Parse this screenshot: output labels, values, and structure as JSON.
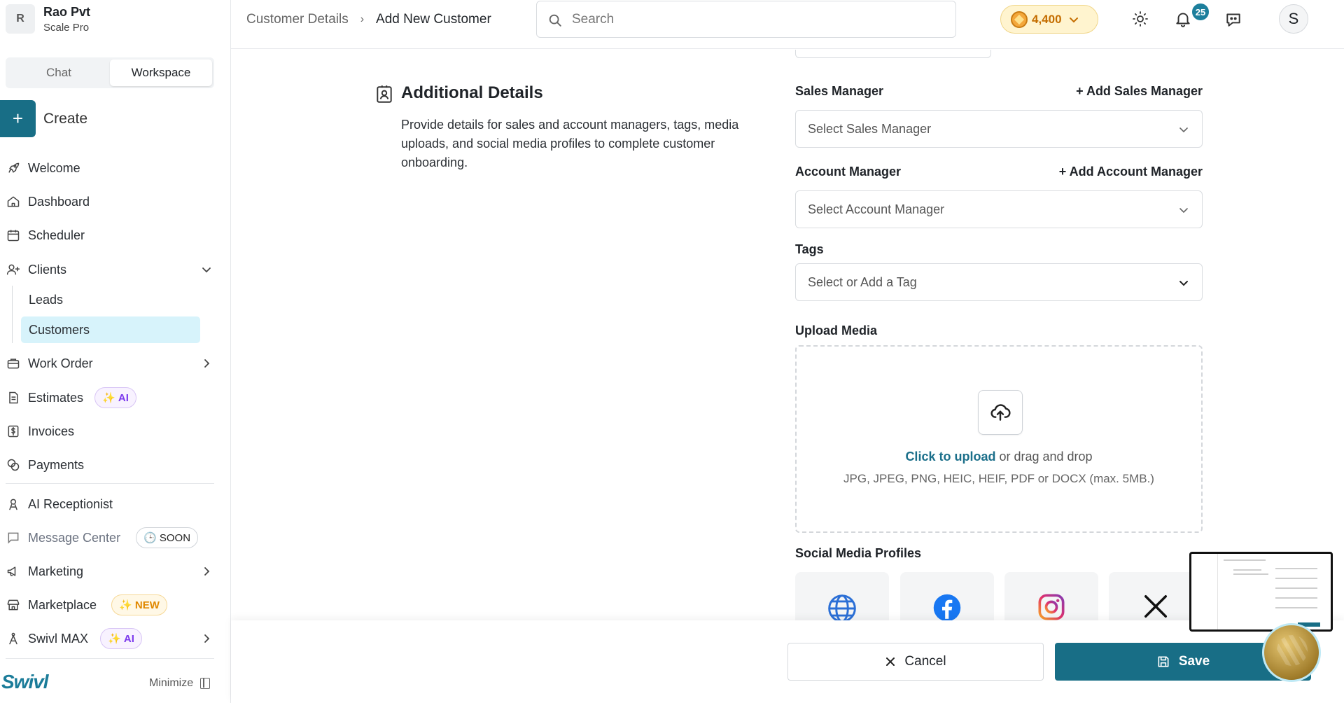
{
  "org": {
    "initial": "R",
    "name": "Rao Pvt",
    "plan": "Scale Pro"
  },
  "mode_tabs": [
    {
      "label": "Chat",
      "active": false
    },
    {
      "label": "Workspace",
      "active": true
    }
  ],
  "create_label": "Create",
  "nav": {
    "welcome": "Welcome",
    "dashboard": "Dashboard",
    "scheduler": "Scheduler",
    "clients": "Clients",
    "leads": "Leads",
    "customers": "Customers",
    "work_order": "Work Order",
    "estimates": "Estimates",
    "invoices": "Invoices",
    "payments": "Payments",
    "ai_receptionist": "AI Receptionist",
    "message_center": "Message Center",
    "marketing": "Marketing",
    "marketplace": "Marketplace",
    "swivl_max": "Swivl MAX"
  },
  "badges": {
    "ai": "AI",
    "soon": "SOON",
    "new": "NEW"
  },
  "brand": "Swivl",
  "minimize_label": "Minimize",
  "breadcrumb": {
    "parent": "Customer Details",
    "current": "Add New Customer"
  },
  "search": {
    "placeholder": "Search"
  },
  "credits": {
    "value": "4,400"
  },
  "notifications": {
    "count": "25"
  },
  "user": {
    "initial": "S"
  },
  "section": {
    "title": "Additional Details",
    "description": "Provide details for sales and account managers, tags, media uploads, and social media profiles to complete customer onboarding."
  },
  "form": {
    "sales_manager": {
      "label": "Sales Manager",
      "add_link": "+ Add Sales Manager",
      "placeholder": "Select Sales Manager"
    },
    "account_manager": {
      "label": "Account Manager",
      "add_link": "+ Add Account Manager",
      "placeholder": "Select Account Manager"
    },
    "tags": {
      "label": "Tags",
      "placeholder": "Select or Add a Tag"
    },
    "upload": {
      "label": "Upload Media",
      "link_text": "Click to upload",
      "rest_text": " or drag and drop",
      "hint": "JPG, JPEG, PNG, HEIC, HEIF, PDF or DOCX (max. 5MB.)"
    },
    "social": {
      "label": "Social Media Profiles",
      "items": [
        "website-icon",
        "facebook-icon",
        "instagram-icon",
        "x-icon"
      ]
    }
  },
  "footer": {
    "cancel_label": "Cancel",
    "save_label": "Save"
  },
  "colors": {
    "primary": "#186e86",
    "active_nav": "#d7f3fb",
    "ai_badge": "#7c3aed",
    "new_badge": "#e08800",
    "coin": "#c46d00",
    "link": "#1b6f8a"
  }
}
